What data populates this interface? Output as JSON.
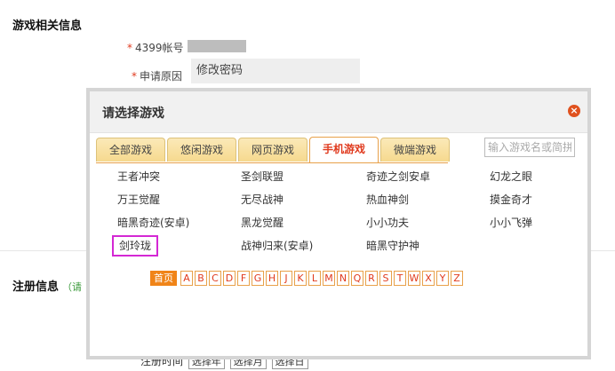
{
  "page": {
    "section1_title": "游戏相关信息",
    "account_label": "4399帐号",
    "reason_label": "申请原因",
    "reason_value": "修改密码",
    "section2_title": "注册信息",
    "section2_hint": "（请",
    "reg_time_label": "注册时间",
    "reg_year": "选择年",
    "reg_month": "选择月",
    "reg_day": "选择日"
  },
  "modal": {
    "title": "请选择游戏",
    "close_icon": "close-icon",
    "tabs": [
      "全部游戏",
      "悠闲游戏",
      "网页游戏",
      "手机游戏",
      "微端游戏"
    ],
    "active_tab": "手机游戏",
    "search_placeholder": "输入游戏名或简拼",
    "games": [
      [
        "王者冲突",
        "圣剑联盟",
        "奇迹之剑安卓",
        "幻龙之眼"
      ],
      [
        "万王觉醒",
        "无尽战神",
        "热血神剑",
        "摸金奇才"
      ],
      [
        "暗黑奇迹(安卓)",
        "黑龙觉醒",
        "小小功夫",
        "小小飞弹"
      ],
      [
        "剑玲珑",
        "战神归来(安卓)",
        "暗黑守护神"
      ]
    ],
    "highlighted_game": "剑玲珑",
    "index_home": "首页",
    "letters": [
      "A",
      "B",
      "C",
      "D",
      "F",
      "G",
      "H",
      "J",
      "K",
      "L",
      "M",
      "N",
      "Q",
      "R",
      "S",
      "T",
      "W",
      "X",
      "Y",
      "Z"
    ]
  },
  "colors": {
    "accent": "#e03a1e",
    "tab_active_border": "#e8a14a",
    "highlight_box": "#d428d4",
    "home_button": "#f08418"
  }
}
